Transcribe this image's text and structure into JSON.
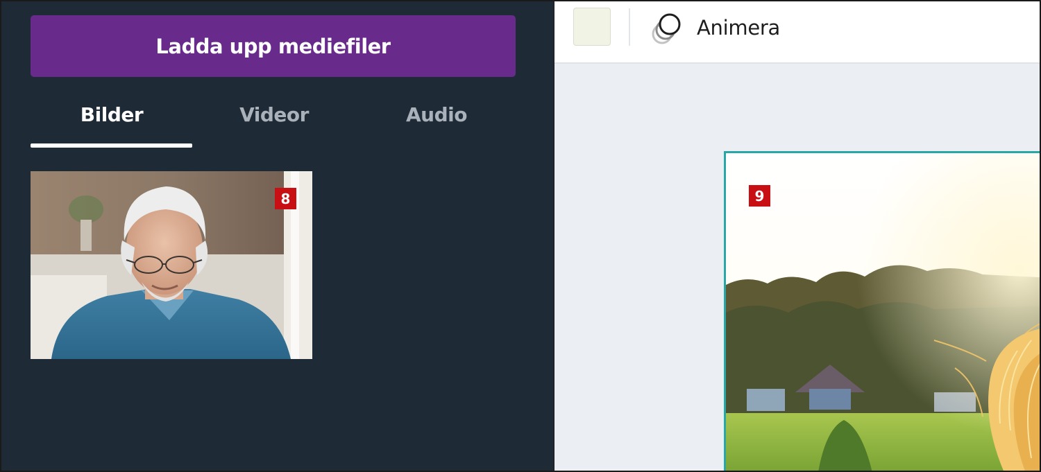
{
  "media_panel": {
    "upload_label": "Ladda upp mediefiler",
    "tabs": [
      {
        "label": "Bilder",
        "active": true
      },
      {
        "label": "Videor",
        "active": false
      },
      {
        "label": "Audio",
        "active": false
      }
    ],
    "images": [
      {
        "badge": "8"
      }
    ]
  },
  "toolbar": {
    "animate_label": "Animera",
    "swatch_color": "#f1f3e5"
  },
  "canvas": {
    "badge": "9",
    "border_color": "#27a7a6"
  },
  "colors": {
    "panel_bg": "#1e2a36",
    "upload_button": "#682b8c",
    "badge": "#c70f14",
    "workspace_bg": "#ebeff3"
  }
}
